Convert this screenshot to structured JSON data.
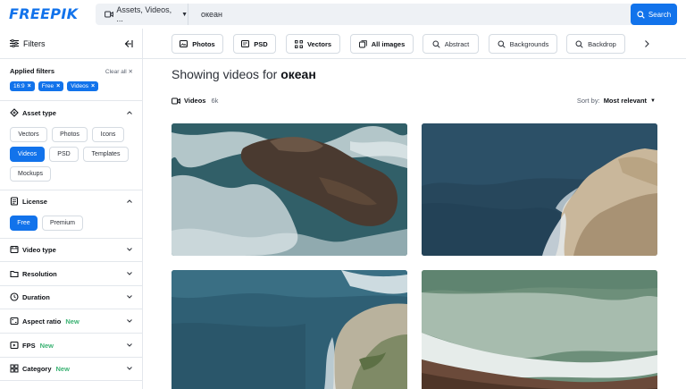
{
  "header": {
    "logo": "FREEPIK",
    "search_type": "Assets, Videos, ...",
    "search_value": "океан",
    "search_button": "Search"
  },
  "sidebar": {
    "title": "Filters",
    "applied_title": "Applied filters",
    "clear_all": "Clear all",
    "applied_chips": [
      "16:9",
      "Free",
      "Videos"
    ],
    "asset_type": {
      "title": "Asset type",
      "row1": [
        "Vectors",
        "Photos",
        "Icons"
      ],
      "row2": [
        "Videos",
        "PSD",
        "Templates"
      ],
      "row3": [
        "Mockups"
      ],
      "selected": "Videos"
    },
    "license": {
      "title": "License",
      "options": [
        "Free",
        "Premium"
      ],
      "selected": "Free"
    },
    "sections": [
      {
        "title": "Video type",
        "badge": ""
      },
      {
        "title": "Resolution",
        "badge": ""
      },
      {
        "title": "Duration",
        "badge": ""
      },
      {
        "title": "Aspect ratio",
        "badge": "New"
      },
      {
        "title": "FPS",
        "badge": "New"
      },
      {
        "title": "Category",
        "badge": "New"
      }
    ]
  },
  "topbar": {
    "pills": [
      "Photos",
      "PSD",
      "Vectors",
      "All images",
      "Abstract",
      "Backgrounds",
      "Backdrop"
    ]
  },
  "main": {
    "title_prefix": "Showing videos for",
    "title_query": "океан",
    "results_tab": "Videos",
    "results_count": "6k",
    "sort_label": "Sort by:",
    "sort_value": "Most relevant"
  },
  "colors": {
    "accent": "#1273eb",
    "new_badge": "#3bb273"
  }
}
